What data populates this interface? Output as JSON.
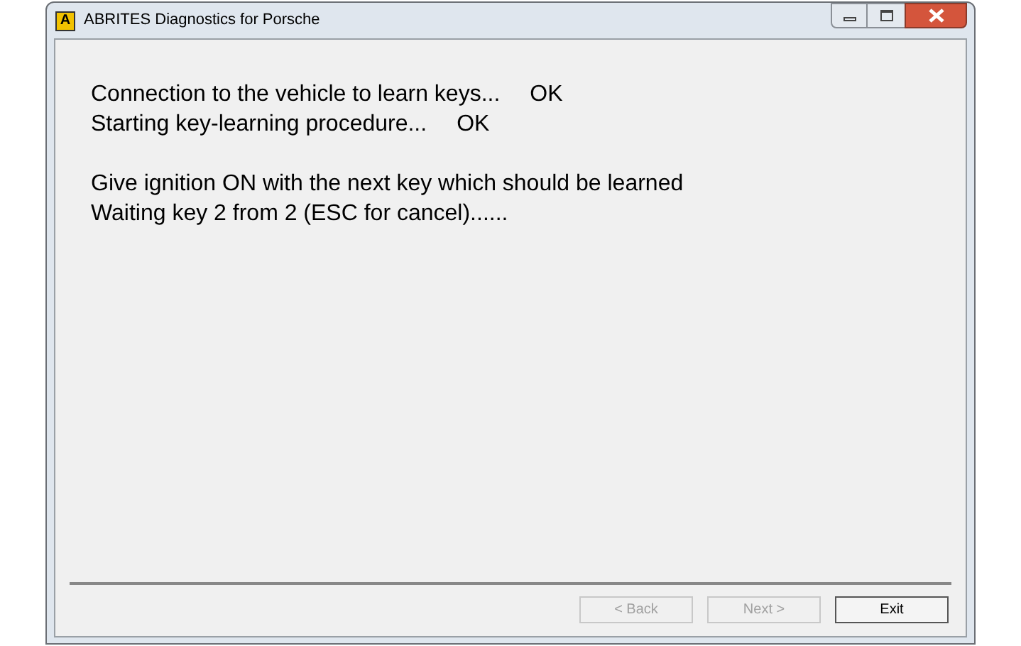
{
  "window": {
    "title": "ABRITES Diagnostics for Porsche",
    "app_icon_letter": "A"
  },
  "status_lines": [
    {
      "text": "Connection to the vehicle to learn keys...",
      "status": "OK"
    },
    {
      "text": "Starting key-learning procedure...",
      "status": "OK"
    }
  ],
  "instructions": [
    "Give ignition ON with the next key which should be learned",
    "Waiting key 2 from 2 (ESC for cancel)......"
  ],
  "buttons": [
    {
      "label": "< Back",
      "disabled": true
    },
    {
      "label": "Next >",
      "disabled": true
    },
    {
      "label": "Exit",
      "disabled": false
    }
  ]
}
